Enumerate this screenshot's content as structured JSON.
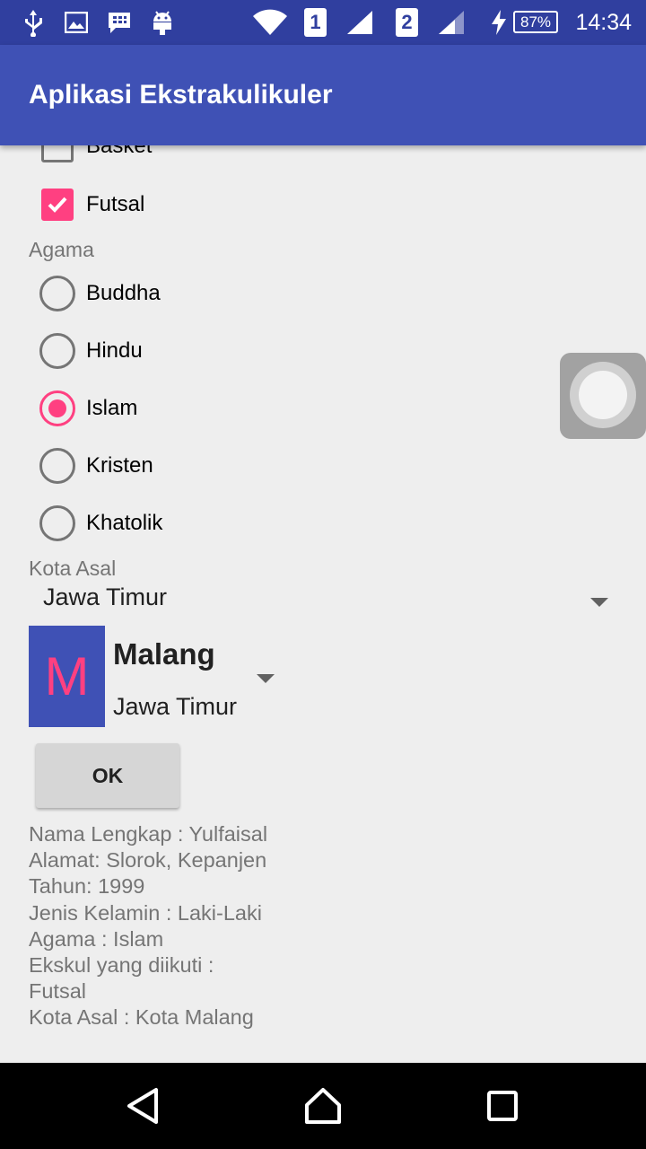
{
  "status_bar": {
    "battery": "87%",
    "time": "14:34",
    "sim1": "1",
    "sim2": "2",
    "icons": [
      "usb-icon",
      "image-icon",
      "bbm-icon",
      "android-icon",
      "wifi-icon",
      "signal-icon",
      "charging-icon",
      "battery-icon"
    ]
  },
  "app_bar": {
    "title": "Aplikasi Ekstrakulikuler"
  },
  "ekskul": {
    "items": [
      {
        "label": "Basket",
        "checked": false
      },
      {
        "label": "Futsal",
        "checked": true
      }
    ]
  },
  "agama": {
    "label": "Agama",
    "options": [
      {
        "label": "Buddha",
        "selected": false
      },
      {
        "label": "Hindu",
        "selected": false
      },
      {
        "label": "Islam",
        "selected": true
      },
      {
        "label": "Kristen",
        "selected": false
      },
      {
        "label": "Khatolik",
        "selected": false
      }
    ]
  },
  "kota_asal": {
    "label": "Kota Asal",
    "province_selected": "Jawa Timur",
    "city": {
      "initial": "M",
      "name": "Malang",
      "province": "Jawa Timur"
    }
  },
  "ok_button": {
    "label": "OK"
  },
  "summary": {
    "lines": [
      "Nama Lengkap : Yulfaisal",
      "Alamat: Slorok, Kepanjen",
      "Tahun: 1999",
      "Jenis Kelamin : Laki-Laki",
      "Agama : Islam",
      "Ekskul yang diikuti :",
      "Futsal",
      "Kota Asal :  Kota Malang"
    ]
  },
  "colors": {
    "primary": "#3f51b5",
    "primary_dark": "#303f9f",
    "accent": "#ff4081"
  }
}
